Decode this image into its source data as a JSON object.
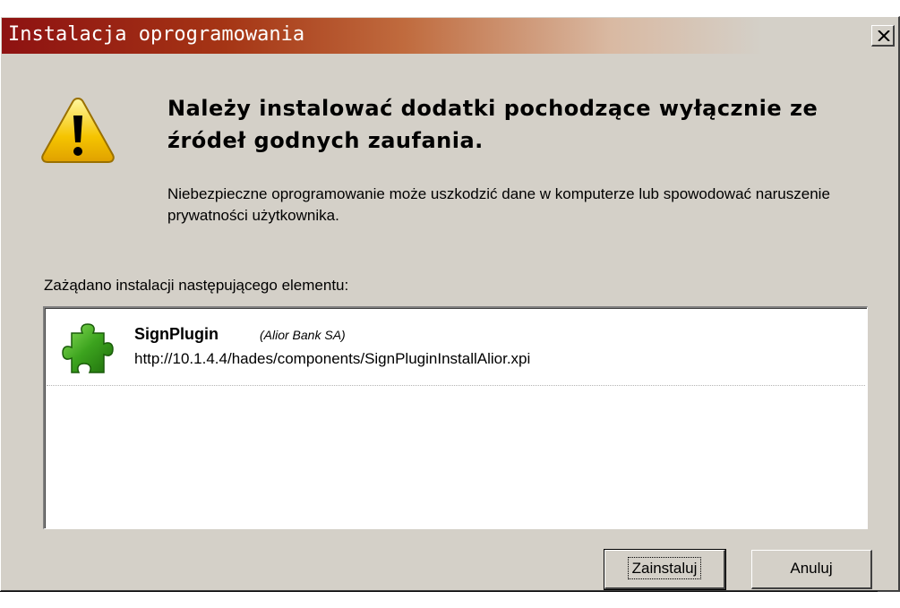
{
  "window": {
    "title": "Instalacja oprogramowania"
  },
  "warning": {
    "icon": "warning-icon",
    "heading": "Należy instalować dodatki pochodzące wyłącznie ze źródeł godnych zaufania.",
    "description": "Niebezpieczne oprogramowanie może uszkodzić dane w komputerze lub spowodować naruszenie prywatności użytkownika."
  },
  "request": {
    "label": "Zażądano instalacji następującego elementu:",
    "items": [
      {
        "icon": "puzzle-icon",
        "name": "SignPlugin",
        "author": "(Alior Bank SA)",
        "url": "http://10.1.4.4/hades/components/SignPluginInstallAlior.xpi"
      }
    ]
  },
  "buttons": {
    "install": "Zainstaluj",
    "cancel": "Anuluj"
  },
  "colors": {
    "titlebar_start": "#8e1212",
    "titlebar_end": "#d4d0c8",
    "dialog_bg": "#d4d0c8",
    "warning_yellow": "#f5c400",
    "puzzle_green": "#3ca31e"
  }
}
